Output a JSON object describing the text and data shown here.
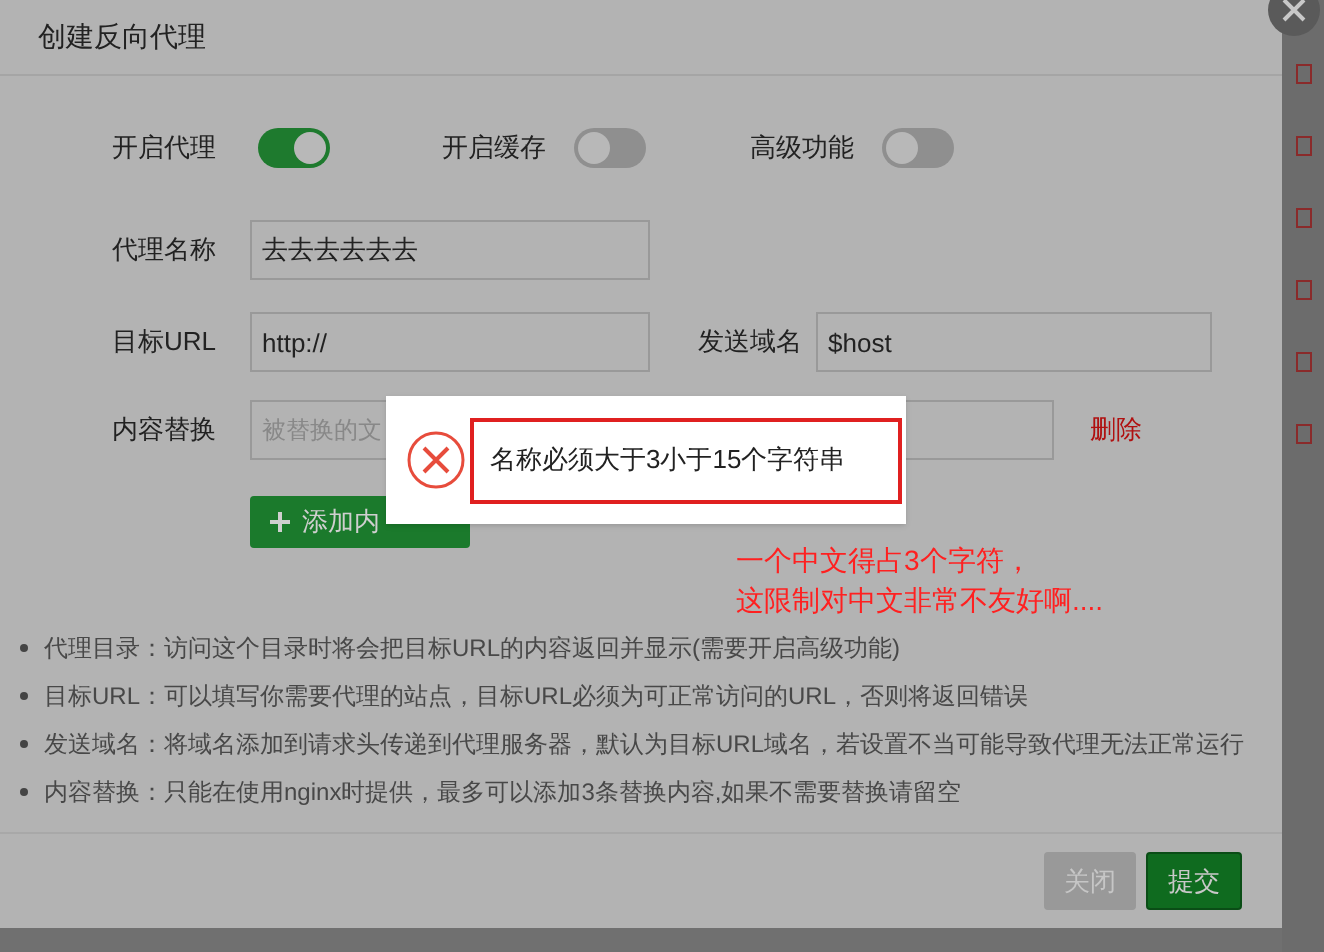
{
  "dialog": {
    "title": "创建反向代理",
    "toggles": [
      {
        "label": "开启代理",
        "on": true
      },
      {
        "label": "开启缓存",
        "on": false
      },
      {
        "label": "高级功能",
        "on": false
      }
    ],
    "name_field": {
      "label": "代理名称",
      "value": "去去去去去去"
    },
    "url_row": {
      "label": "目标URL",
      "value": "http://",
      "host_label": "发送域名",
      "host_value": "$host"
    },
    "replace_row": {
      "label": "内容替换",
      "placeholder": "被替换的文",
      "delete": "删除"
    },
    "add_button": {
      "label": "添加内"
    },
    "notes": [
      "代理目录：访问这个目录时将会把目标URL的内容返回并显示(需要开启高级功能)",
      "目标URL：可以填写你需要代理的站点，目标URL必须为可正常访问的URL，否则将返回错误",
      "发送域名：将域名添加到请求头传递到代理服务器，默认为目标URL域名，若设置不当可能导致代理无法正常运行",
      "内容替换：只能在使用nginx时提供，最多可以添加3条替换内容,如果不需要替换请留空"
    ],
    "buttons": [
      {
        "label": "关闭",
        "kind": "close"
      },
      {
        "label": "提交",
        "kind": "submit"
      }
    ]
  },
  "toast": {
    "message": "名称必须大于3小于15个字符串"
  },
  "annotation": [
    "一个中文得占3个字符，",
    "这限制对中文非常不友好啊...."
  ]
}
